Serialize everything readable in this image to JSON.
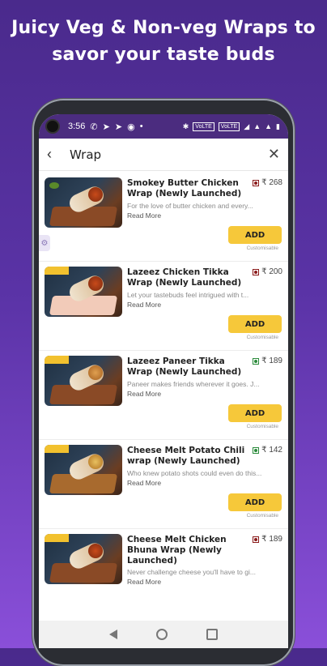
{
  "headline": {
    "line1": "Juicy Veg & Non-veg Wraps to",
    "line2": "savor your taste buds"
  },
  "statusbar": {
    "time": "3:56",
    "icons": [
      "whatsapp-icon",
      "telegram-icon",
      "telegram-icon",
      "chrome-icon",
      "dot-icon"
    ],
    "right": [
      "bluetooth-icon",
      "volte-icon",
      "volte-icon",
      "wifi-icon",
      "signal-icon",
      "signal-icon",
      "battery-icon"
    ],
    "pill1": "VoLTE",
    "pill2": "VoLTE"
  },
  "search": {
    "value": "Wrap",
    "back_icon": "back-arrow-icon",
    "clear_icon": "close-icon"
  },
  "items": [
    {
      "title": "Smokey Butter Chicken Wrap (Newly Launched)",
      "price": "₹ 268",
      "type": "nonveg",
      "desc": "For the love of butter chicken and every...",
      "read_more": "Read More",
      "add": "ADD",
      "custom": "Customisable"
    },
    {
      "title": "Lazeez Chicken Tikka Wrap (Newly Launched)",
      "price": "₹ 200",
      "type": "nonveg",
      "desc": "Let your tastebuds feel intrigued with t...",
      "read_more": "Read More",
      "add": "ADD",
      "custom": "Customisable"
    },
    {
      "title": "Lazeez Paneer Tikka Wrap (Newly Launched)",
      "price": "₹ 189",
      "type": "veg",
      "desc": "Paneer makes friends wherever it goes. J...",
      "read_more": "Read More",
      "add": "ADD",
      "custom": "Customisable"
    },
    {
      "title": "Cheese Melt Potato Chili wrap (Newly Launched)",
      "price": "₹ 142",
      "type": "veg",
      "desc": "Who knew potato shots could even do this...",
      "read_more": "Read More",
      "add": "ADD",
      "custom": "Customisable"
    },
    {
      "title": "Cheese Melt Chicken Bhuna Wrap (Newly Launched)",
      "price": "₹ 189",
      "type": "nonveg",
      "desc": "Never challenge cheese you'll have to gi...",
      "read_more": "Read More"
    }
  ],
  "colors": {
    "accent": "#f6c83a",
    "purple": "#5a33a6",
    "veg": "#2a8a3a",
    "nonveg": "#8a1a1a"
  }
}
